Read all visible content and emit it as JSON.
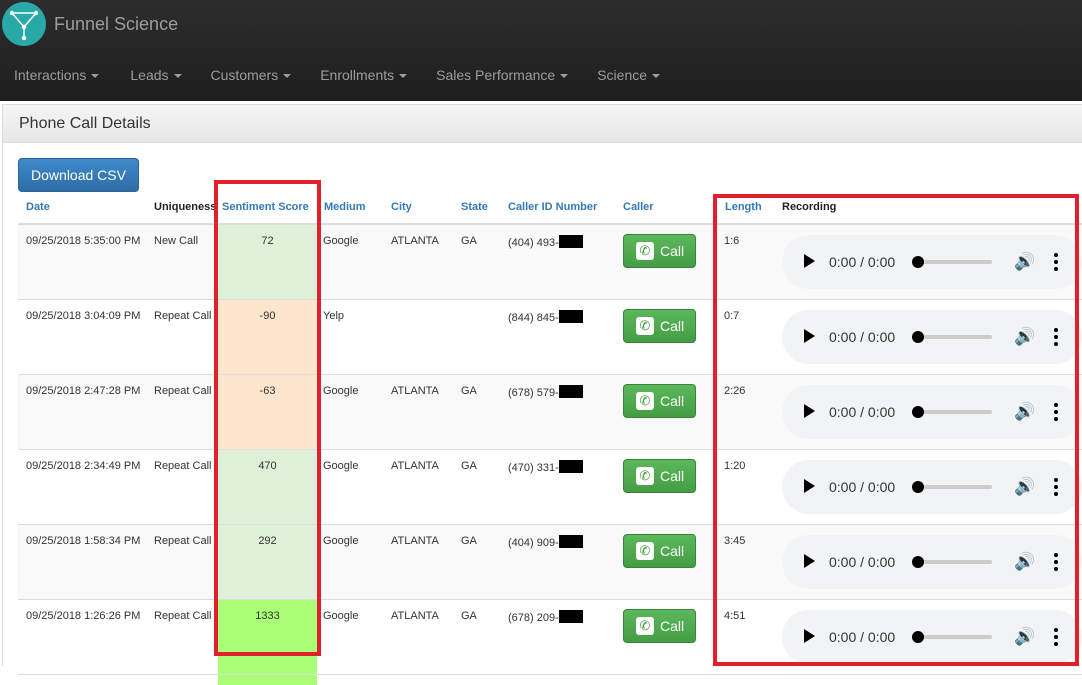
{
  "app": {
    "title": "Funnel Science"
  },
  "nav": [
    "Interactions",
    "Leads",
    "Customers",
    "Enrollments",
    "Sales Performance",
    "Science"
  ],
  "panel": {
    "title": "Phone Call Details"
  },
  "download_label": "Download CSV",
  "table": {
    "headers": [
      "Date",
      "Uniqueness",
      "Sentiment Score",
      "Medium",
      "City",
      "State",
      "Caller ID Number",
      "Caller",
      "Length",
      "Recording"
    ],
    "rows": [
      {
        "date": "09/25/2018 5:35:00 PM",
        "uniqueness": "New Call",
        "sentiment": "72",
        "medium": "Google",
        "city": "ATLANTA",
        "state": "GA",
        "caller_id": "(404) 493-",
        "call_label": "Call",
        "length": "1:6",
        "time": "0:00 / 0:00"
      },
      {
        "date": "09/25/2018 3:04:09 PM",
        "uniqueness": "Repeat Call",
        "sentiment": "-90",
        "medium": "Yelp",
        "city": "",
        "state": "",
        "caller_id": "(844) 845-",
        "call_label": "Call",
        "length": "0:7",
        "time": "0:00 / 0:00"
      },
      {
        "date": "09/25/2018 2:47:28 PM",
        "uniqueness": "Repeat Call",
        "sentiment": "-63",
        "medium": "Google",
        "city": "ATLANTA",
        "state": "GA",
        "caller_id": "(678) 579-",
        "call_label": "Call",
        "length": "2:26",
        "time": "0:00 / 0:00"
      },
      {
        "date": "09/25/2018 2:34:49 PM",
        "uniqueness": "Repeat Call",
        "sentiment": "470",
        "medium": "Google",
        "city": "ATLANTA",
        "state": "GA",
        "caller_id": "(470) 331-",
        "call_label": "Call",
        "length": "1:20",
        "time": "0:00 / 0:00"
      },
      {
        "date": "09/25/2018 1:58:34 PM",
        "uniqueness": "Repeat Call",
        "sentiment": "292",
        "medium": "Google",
        "city": "ATLANTA",
        "state": "GA",
        "caller_id": "(404) 909-",
        "call_label": "Call",
        "length": "3:45",
        "time": "0:00 / 0:00"
      },
      {
        "date": "09/25/2018 1:26:26 PM",
        "uniqueness": "Repeat Call",
        "sentiment": "1333",
        "medium": "Google",
        "city": "ATLANTA",
        "state": "GA",
        "caller_id": "(678) 209-",
        "call_label": "Call",
        "length": "4:51",
        "time": "0:00 / 0:00"
      }
    ]
  },
  "colors": {
    "sentiment_positive": "#dff0d8",
    "sentiment_negative": "#fce5cd",
    "sentiment_high": "#aaff77",
    "highlight_border": "#e0202a"
  }
}
